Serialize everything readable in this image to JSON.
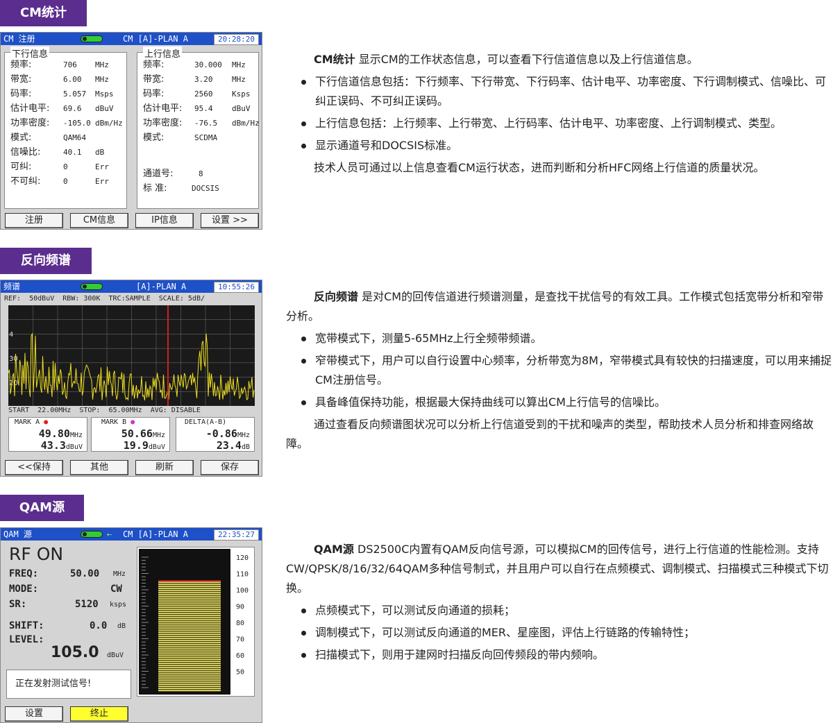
{
  "sections": {
    "cm": {
      "tab": "CM统计"
    },
    "spectrum": {
      "tab": "反向频谱"
    },
    "qam": {
      "tab": "QAM源"
    }
  },
  "cm_screen": {
    "title_left": "CM 注册",
    "title_mid": "CM [A]-PLAN A",
    "clock": "20:28:20",
    "down": {
      "title": "下行信息",
      "rows": [
        {
          "k": "频率:",
          "v": "706",
          "u": "MHz"
        },
        {
          "k": "带宽:",
          "v": "6.00",
          "u": "MHz"
        },
        {
          "k": "码率:",
          "v": "5.057",
          "u": "Msps"
        },
        {
          "k": "估计电平:",
          "v": "69.6",
          "u": "dBuV"
        },
        {
          "k": "功率密度:",
          "v": "-105.0",
          "u": "dBm/Hz"
        },
        {
          "k": "模式:",
          "v": "QAM64",
          "u": ""
        },
        {
          "k": "信噪比:",
          "v": "40.1",
          "u": "dB"
        },
        {
          "k": "可纠:",
          "v": "0",
          "u": "Err"
        },
        {
          "k": "不可纠:",
          "v": "0",
          "u": "Err"
        }
      ]
    },
    "up": {
      "title": "上行信息",
      "rows": [
        {
          "k": "频率:",
          "v": "30.000",
          "u": "MHz"
        },
        {
          "k": "带宽:",
          "v": "3.20",
          "u": "MHz"
        },
        {
          "k": "码率:",
          "v": "2560",
          "u": "Ksps"
        },
        {
          "k": "估计电平:",
          "v": "95.4",
          "u": "dBuV"
        },
        {
          "k": "功率密度:",
          "v": "-76.5",
          "u": "dBm/Hz"
        },
        {
          "k": "模式:",
          "v": "SCDMA",
          "u": ""
        }
      ],
      "channel_label": "通道号:",
      "channel_value": "8",
      "std_label": "标 准:",
      "std_value": "DOCSIS"
    },
    "buttons": [
      "注册",
      "CM信息",
      "IP信息",
      "设置 >>"
    ]
  },
  "cm_text": {
    "lead_bold": "CM统计",
    "lead": " 显示CM的工作状态信息，可以查看下行信道信息以及上行信道信息。",
    "bullets": [
      "下行信道信息包括：下行频率、下行带宽、下行码率、估计电平、功率密度、下行调制模式、信噪比、可纠正误码、不可纠正误码。",
      "上行信息包括：上行频率、上行带宽、上行码率、估计电平、功率密度、上行调制模式、类型。",
      "显示通道号和DOCSIS标准。"
    ],
    "tail": "技术人员可通过以上信息查看CM运行状态，进而判断和分析HFC网络上行信道的质量状况。"
  },
  "spec_screen": {
    "title_left": "频谱",
    "title_mid": "[A]-PLAN A",
    "clock": "10:55:26",
    "params": "REF:  50dBuV  RBW: 300K  TRC:SAMPLE  SCALE: 5dB/",
    "y_labels": [
      "4",
      "30",
      "20"
    ],
    "footer": "START  22.00MHz  STOP:  65.00MHz  AVG: DISABLE",
    "mark_a": {
      "label": "MARK A",
      "freq": "49.80",
      "freq_u": "MHz",
      "lvl": "43.3",
      "lvl_u": "dBuV"
    },
    "mark_b": {
      "label": "MARK B",
      "freq": "50.66",
      "freq_u": "MHz",
      "lvl": "19.9",
      "lvl_u": "dBuV"
    },
    "delta": {
      "label": "DELTA(A-B)",
      "freq": "-0.86",
      "freq_u": "MHz",
      "lvl": "23.4",
      "lvl_u": "dB"
    },
    "buttons": [
      "<<保持",
      "其他",
      "刷新",
      "保存"
    ],
    "colors": {
      "trace": "#f0e020",
      "marker": "#cc2020",
      "bg": "#1a1a1a"
    }
  },
  "spec_text": {
    "lead_bold": "反向频谱",
    "lead": " 是对CM的回传信道进行频谱测量，是查找干扰信号的有效工具。工作模式包括宽带分析和窄带分析。",
    "bullets": [
      "宽带模式下，测量5-65MHz上行全频带频谱。",
      "窄带模式下，用户可以自行设置中心频率，分析带宽为8M，窄带模式具有较快的扫描速度，可以用来捕捉CM注册信号。",
      "具备峰值保持功能，根据最大保持曲线可以算出CM上行信号的信噪比。"
    ],
    "tail": "通过查看反向频谱图状况可以分析上行信道受到的干扰和噪声的类型，帮助技术人员分析和排查网络故障。"
  },
  "qam_screen": {
    "title_left": "QAM 源",
    "title_mid": "CM [A]-PLAN A",
    "clock": "22:35:27",
    "rf": "RF ON",
    "freq_k": "FREQ:",
    "freq_v": "50.00",
    "freq_u": "MHz",
    "mode_k": "MODE:",
    "mode_v": "CW",
    "sr_k": "SR:",
    "sr_v": "5120",
    "sr_u": "ksps",
    "shift_k": "SHIFT:",
    "shift_v": "0.0",
    "shift_u": "dB",
    "level_k": "LEVEL:",
    "level_v": "105.0",
    "level_u": "dBuV",
    "status": "正在发射测试信号!",
    "scale": [
      "120",
      "110",
      "100",
      "90",
      "80",
      "70",
      "60",
      "50"
    ],
    "bar_level": 105.0,
    "buttons": [
      "设置",
      "终止"
    ],
    "colors": {
      "bar": "#e8e060",
      "bar_top": "#cc2020",
      "active_btn": "#ffff30"
    }
  },
  "qam_text": {
    "lead_bold": "QAM源",
    "lead": " DS2500C内置有QAM反向信号源，可以模拟CM的回传信号，进行上行信道的性能检测。支持CW/QPSK/8/16/32/64QAM多种信号制式，并且用户可以自行在点频模式、调制模式、扫描模式三种模式下切换。",
    "bullets": [
      "点频模式下，可以测试反向通道的损耗；",
      "调制模式下，可以测试反向通道的MER、星座图，评估上行链路的传输特性；",
      "扫描模式下，则用于建网时扫描反向回传频段的带内频响。"
    ]
  }
}
